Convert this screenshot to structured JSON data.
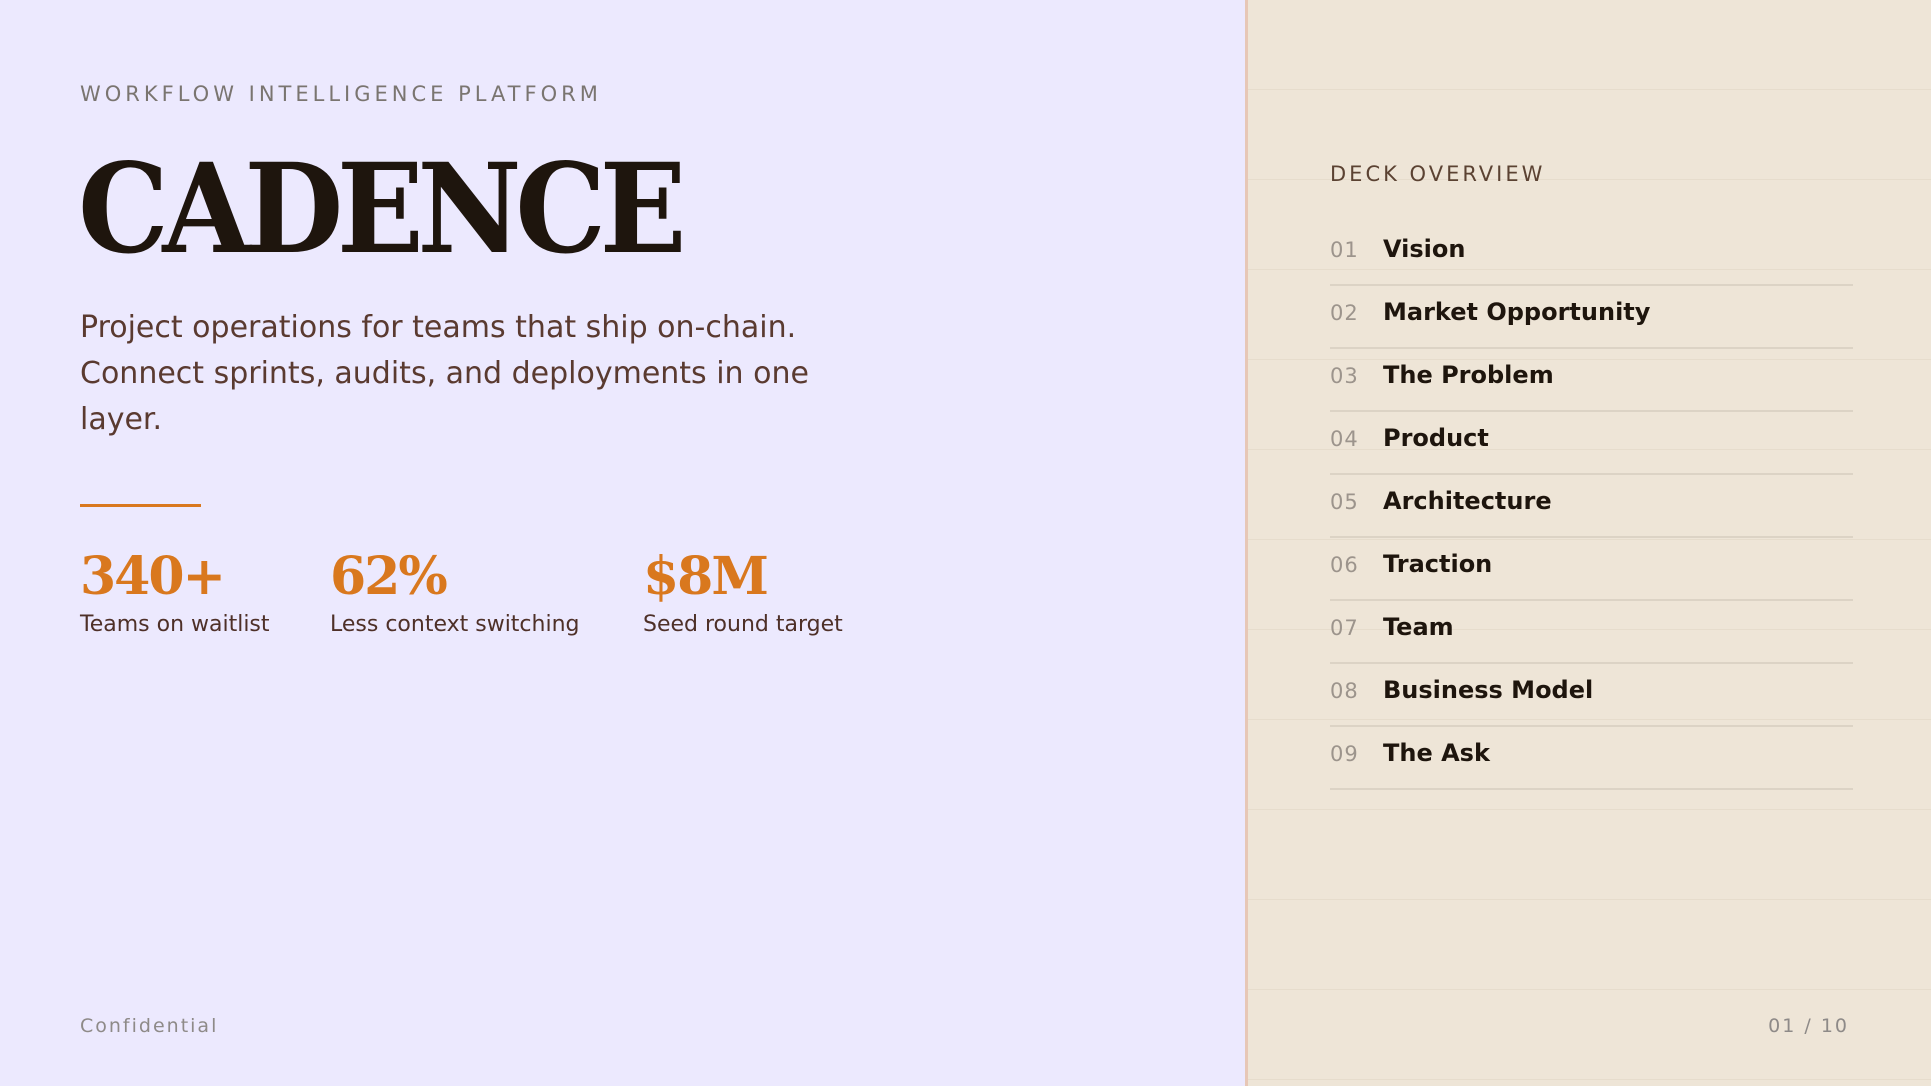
{
  "hero": {
    "eyebrow": "WORKFLOW INTELLIGENCE PLATFORM",
    "title": "CADENCE",
    "tagline": "Project operations for teams that ship on-chain. Connect sprints, audits, and deployments in one layer."
  },
  "stats": [
    {
      "value": "340+",
      "label": "Teams on waitlist"
    },
    {
      "value": "62%",
      "label": "Less context switching"
    },
    {
      "value": "$8M",
      "label": "Seed round target"
    }
  ],
  "footer": {
    "left": "Confidential",
    "page": "01 / 10"
  },
  "overview": {
    "title": "DECK OVERVIEW",
    "items": [
      {
        "num": "01",
        "label": "Vision"
      },
      {
        "num": "02",
        "label": "Market Opportunity"
      },
      {
        "num": "03",
        "label": "The Problem"
      },
      {
        "num": "04",
        "label": "Product"
      },
      {
        "num": "05",
        "label": "Architecture"
      },
      {
        "num": "06",
        "label": "Traction"
      },
      {
        "num": "07",
        "label": "Team"
      },
      {
        "num": "08",
        "label": "Business Model"
      },
      {
        "num": "09",
        "label": "The Ask"
      }
    ]
  },
  "colors": {
    "left_bg": "#ECE9FE",
    "right_bg": "#EEE5D7",
    "accent": "#D9781E",
    "ink": "#1E150D"
  }
}
